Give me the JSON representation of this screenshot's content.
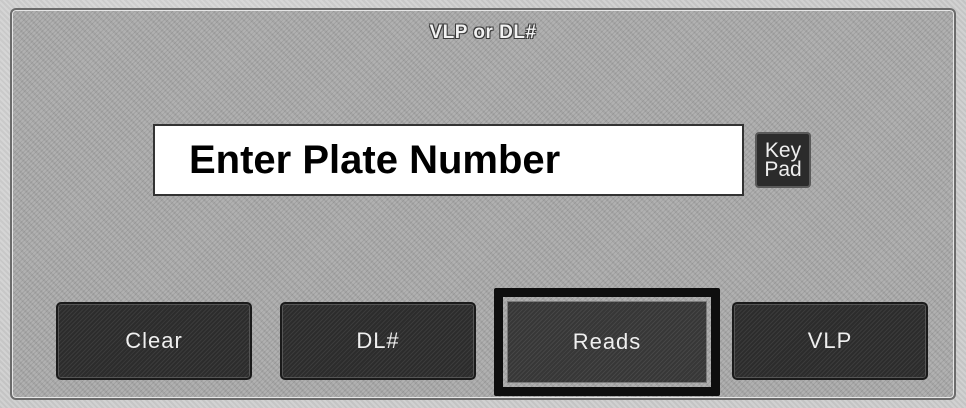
{
  "panel": {
    "title": "VLP or DL#"
  },
  "plate_input": {
    "placeholder": "Enter Plate Number",
    "value": ""
  },
  "keypad": {
    "line1": "Key",
    "line2": "Pad"
  },
  "buttons": {
    "clear": "Clear",
    "dl": "DL#",
    "reads": "Reads",
    "vlp": "VLP"
  },
  "selected_button": "Reads"
}
